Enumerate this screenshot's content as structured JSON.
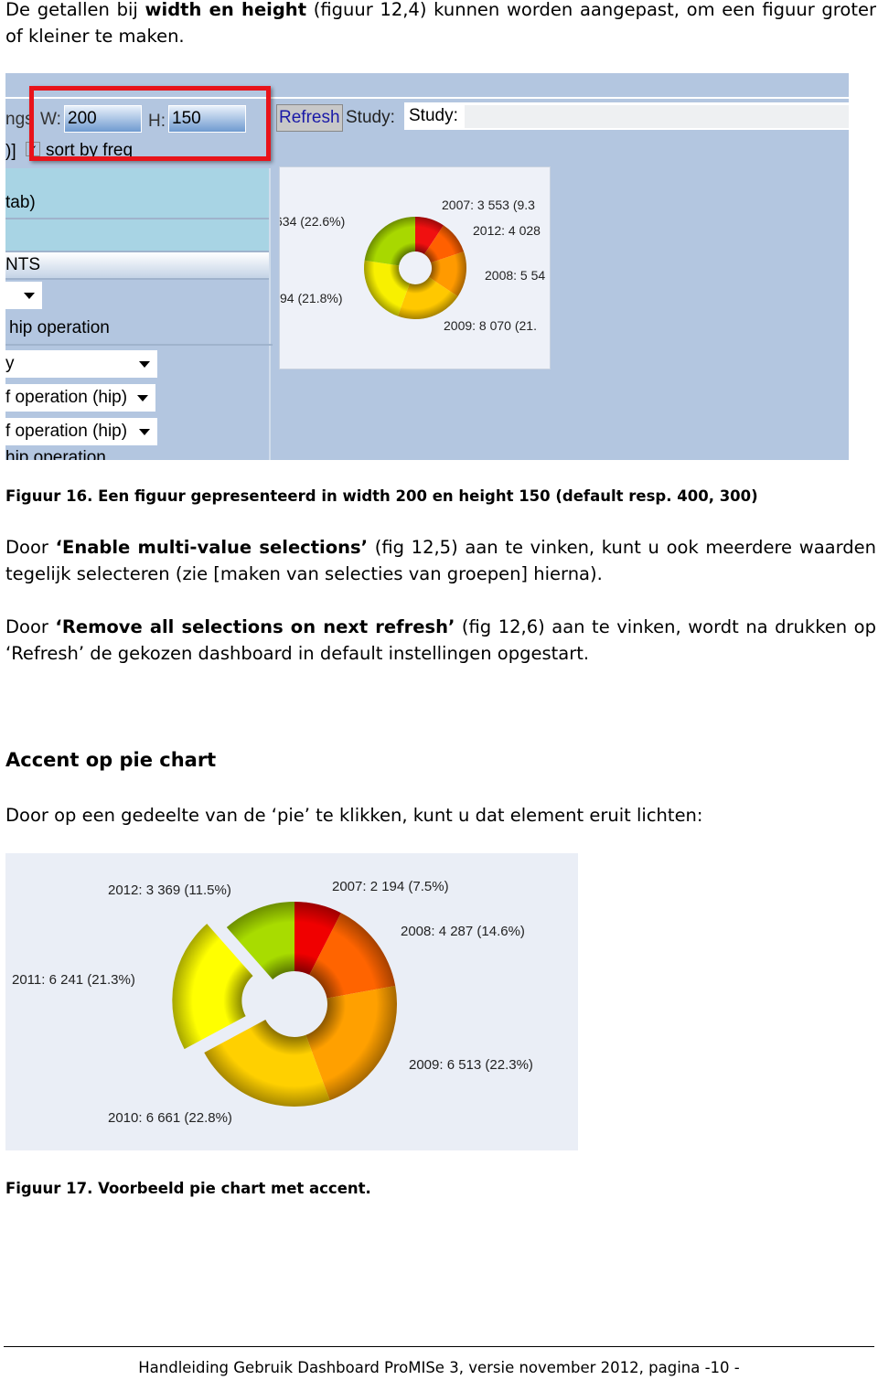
{
  "intro": {
    "pre": "De getallen bij ",
    "bold": "width en height",
    "post": " (figuur 12,4) kunnen worden aangepast, om een figuur groter of kleiner te maken."
  },
  "figure16": {
    "toolbar": {
      "settings_fragment": "ngs",
      "w_label": "W:",
      "w_value": "200",
      "h_label": "H:",
      "h_value": "150",
      "refresh": "Refresh",
      "study_label": "Study:",
      "study_value": "Study:",
      "row2_fragment": ")]",
      "sort_label": "sort by freq",
      "sort_checked": true
    },
    "left_rows": [
      "tab)",
      "",
      "NTS",
      "",
      "hip operation",
      "y",
      "f operation (hip)",
      "f operation (hip)",
      "hip operation"
    ],
    "pie": {
      "labels": [
        "2007: 3 553 (9.3",
        "2012: 4 028",
        "2008: 5 54",
        "2009: 8 070 (21.",
        "94 (21.8%)",
        "634 (22.6%)"
      ],
      "values_percent": [
        9.3,
        10.5,
        14.5,
        21.1,
        21.8,
        22.6
      ],
      "colors": [
        "#f01010",
        "#ff6000",
        "#ff9a00",
        "#ffc800",
        "#f8f000",
        "#a8d800"
      ]
    },
    "highlight_color": "#e8131a",
    "caption": "Figuur 16. Een figuur gepresenteerd in width 200 en height 150 (default resp. 400, 300)"
  },
  "para1": {
    "pre": "Door ",
    "bold": "‘Enable multi-value selections’",
    "post": " (fig 12,5) aan te vinken, kunt u ook meerdere waarden tegelijk selecteren (zie [maken van selecties van groepen] hierna)."
  },
  "para2": {
    "pre": "Door ",
    "bold": "‘Remove all selections on next refresh’",
    "post": " (fig 12,6) aan te vinken, wordt na drukken op ‘Refresh’ de gekozen dashboard in default instellingen opgestart."
  },
  "section_title": "Accent op pie chart",
  "para3": "Door op een gedeelte van de ‘pie’ te klikken, kunt u dat element eruit lichten:",
  "chart_data": {
    "type": "pie",
    "style": "donut",
    "categories": [
      "2007",
      "2008",
      "2009",
      "2010",
      "2011",
      "2012"
    ],
    "values": [
      2194,
      4287,
      6513,
      6661,
      6241,
      3369
    ],
    "percent": [
      7.5,
      14.6,
      22.3,
      22.8,
      21.3,
      11.5
    ],
    "labels": [
      "2007: 2 194 (7.5%)",
      "2008: 4 287 (14.6%)",
      "2009: 6 513 (22.3%)",
      "2010: 6 661 (22.8%)",
      "2011: 6 241 (21.3%)",
      "2012: 3 369 (11.5%)"
    ],
    "colors": [
      "#f00000",
      "#ff6400",
      "#ffa000",
      "#ffd000",
      "#ffff00",
      "#a8dc00"
    ],
    "exploded": "2011"
  },
  "figure17_caption": "Figuur 17. Voorbeeld pie chart met accent.",
  "footer": "Handleiding Gebruik Dashboard ProMISe 3, versie november 2012, pagina -10 -"
}
